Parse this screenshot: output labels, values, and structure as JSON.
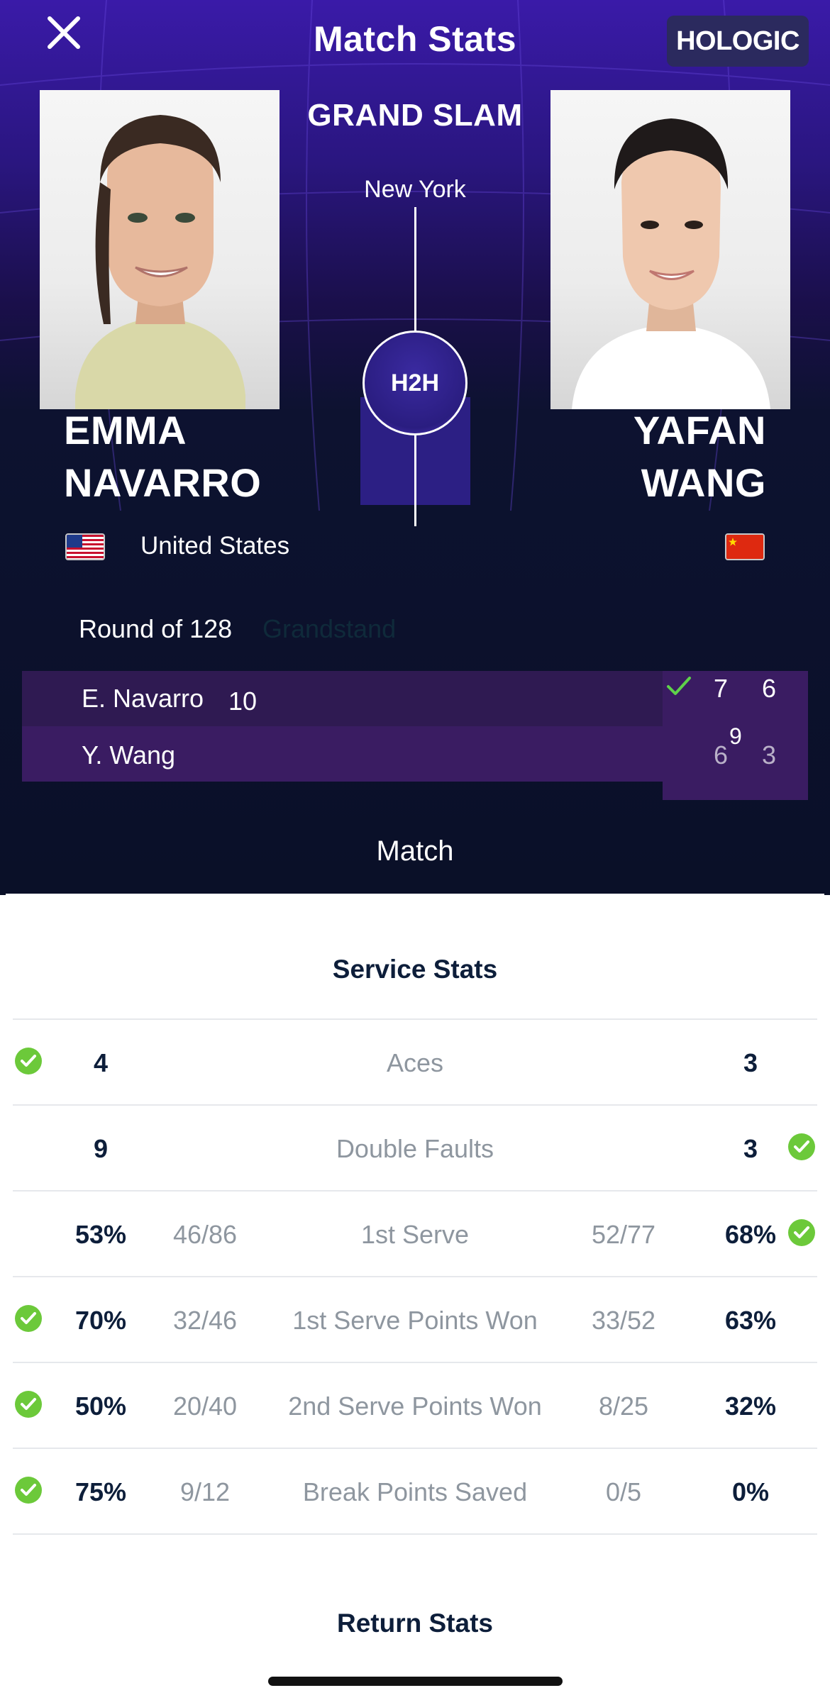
{
  "header": {
    "title": "Match Stats",
    "sponsor": "HOLOGIC",
    "tournament": "GRAND SLAM",
    "city": "New York",
    "h2h_label": "H2H"
  },
  "players": {
    "left": {
      "name_line1": "EMMA",
      "name_line2": "NAVARRO",
      "country": "United States",
      "flag": "us-flag-icon"
    },
    "right": {
      "name_line1": "YAFAN",
      "name_line2": "WANG",
      "country": "",
      "flag": "china-flag-icon"
    }
  },
  "match": {
    "round": "Round of 128",
    "court": "Grandstand",
    "scores": [
      {
        "name": "E. Navarro",
        "seed": "10",
        "sets": [
          "7",
          "6"
        ],
        "winner": true
      },
      {
        "name": "Y. Wang",
        "seed": "",
        "sets": [
          "6",
          "3"
        ],
        "tiebreak": "9",
        "winner": false
      }
    ]
  },
  "tabs": {
    "active": "Match"
  },
  "service_stats": {
    "title": "Service Stats",
    "rows": [
      {
        "label": "Aces",
        "left_value": "4",
        "left_fraction": "",
        "right_value": "3",
        "right_fraction": "",
        "leader": "left"
      },
      {
        "label": "Double Faults",
        "left_value": "9",
        "left_fraction": "",
        "right_value": "3",
        "right_fraction": "",
        "leader": "right"
      },
      {
        "label": "1st Serve",
        "left_value": "53%",
        "left_fraction": "46/86",
        "right_value": "68%",
        "right_fraction": "52/77",
        "leader": "right"
      },
      {
        "label": "1st Serve Points Won",
        "left_value": "70%",
        "left_fraction": "32/46",
        "right_value": "63%",
        "right_fraction": "33/52",
        "leader": "left"
      },
      {
        "label": "2nd Serve Points Won",
        "left_value": "50%",
        "left_fraction": "20/40",
        "right_value": "32%",
        "right_fraction": "8/25",
        "leader": "left"
      },
      {
        "label": "Break Points Saved",
        "left_value": "75%",
        "left_fraction": "9/12",
        "right_value": "0%",
        "right_fraction": "0/5",
        "leader": "left"
      }
    ]
  },
  "return_stats": {
    "title": "Return Stats"
  },
  "colors": {
    "accent_green": "#5fd14a",
    "bg_dark": "#0a1028",
    "purple": "#3a1aa8",
    "row_purple": "#2f1a52"
  }
}
